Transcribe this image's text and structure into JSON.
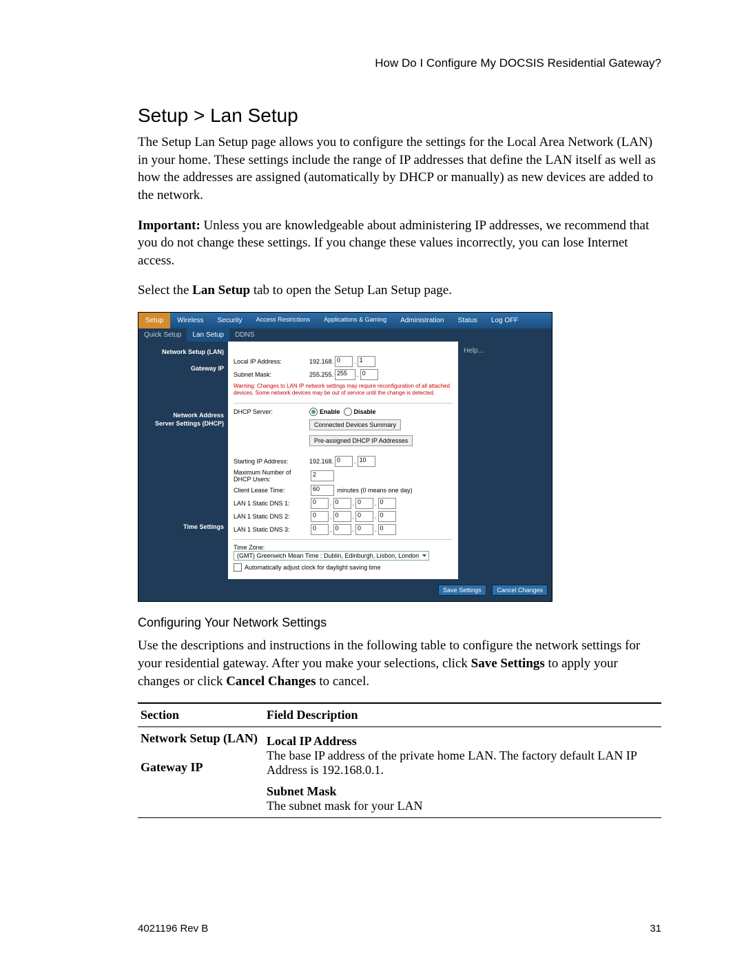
{
  "doc": {
    "running_header": "How Do I Configure My DOCSIS Residential Gateway?",
    "title": "Setup > Lan Setup",
    "intro": "The Setup Lan Setup page allows you to configure the settings for the Local Area Network (LAN) in your home. These settings include the range of IP addresses that define the LAN itself as well as how the addresses are assigned (automatically by DHCP or manually) as new devices are added to the network.",
    "important_label": "Important:",
    "important_body": " Unless you are knowledgeable about administering IP addresses, we recommend that you do not change these settings. If you change these values incorrectly, you can lose Internet access.",
    "select_pre": "Select the ",
    "select_bold": "Lan Setup",
    "select_post": " tab to open the Setup Lan Setup page.",
    "config_heading": "Configuring Your Network Settings",
    "config_body_1": "Use the descriptions and instructions in the following table to configure the network settings for your residential gateway. After you make your selections, click ",
    "config_bold_1": "Save Settings",
    "config_body_2": " to apply your changes or click ",
    "config_bold_2": "Cancel Changes",
    "config_body_3": " to cancel.",
    "footer_left": "4021196 Rev B",
    "footer_right": "31"
  },
  "table": {
    "col1": "Section",
    "col2": "Field Description",
    "row1_section_a": "Network Setup (LAN)",
    "row1_section_b": "Gateway IP",
    "row1_f1": "Local IP Address",
    "row1_d1": "The base IP address of the private home LAN. The factory default LAN IP Address is 192.168.0.1.",
    "row1_f2": "Subnet Mask",
    "row1_d2": "The subnet mask for your LAN"
  },
  "ui": {
    "tabs1": [
      "Setup",
      "Wireless",
      "Security",
      "Access Restrictions",
      "Applications & Gaming",
      "Administration",
      "Status",
      "Log OFF"
    ],
    "tabs2": [
      "Quick Setup",
      "Lan Setup",
      "DDNS"
    ],
    "sections": {
      "net": "Network Setup (LAN)",
      "gw": "Gateway IP",
      "dhcp_a": "Network Address",
      "dhcp_b": "Server Settings (DHCP)",
      "time": "Time Settings"
    },
    "labels": {
      "local_ip": "Local IP Address:",
      "subnet": "Subnet Mask:",
      "dhcp_server": "DHCP Server:",
      "enable": "Enable",
      "disable": "Disable",
      "conn_summary": "Connected Devices Summary",
      "preassigned": "Pre-assigned DHCP IP Addresses",
      "start_ip": "Starting IP Address:",
      "max_users_a": "Maximum Number of",
      "max_users_b": "DHCP Users:",
      "lease": "Client Lease Time:",
      "lease_unit": "minutes (0 means one day)",
      "dns1": "LAN 1 Static DNS 1:",
      "dns2": "LAN 1 Static DNS 2:",
      "dns3": "LAN 1 Static DNS 3:",
      "tz": "Time Zone:",
      "tz_value": "(GMT) Greenwich Mean Time : Dublin, Edinburgh, Lisbon, London",
      "dst": "Automatically adjust clock for daylight saving time",
      "save": "Save Settings",
      "cancel": "Cancel Changes",
      "help": "Help..."
    },
    "values": {
      "ip_prefix": "192.168.",
      "ip_o3": "0",
      "ip_o4": "1",
      "mask_prefix": "255.255.",
      "mask_o3": "255",
      "mask_o4": "0",
      "warning": "Warning: Changes to LAN IP network settings may require reconfiguration of all attached devices. Some network devices may be out of service until the change is detected.",
      "start_o4": "10",
      "max_users": "2",
      "lease": "60",
      "dns_zero": "0"
    }
  }
}
